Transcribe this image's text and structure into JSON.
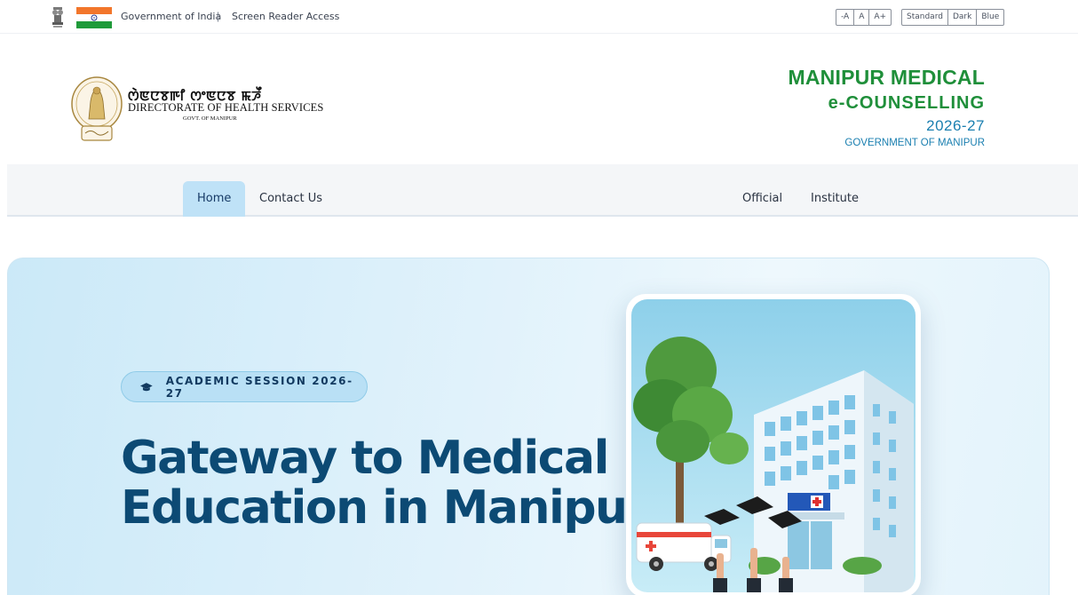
{
  "gov_strip": {
    "gov_label": "Government of India",
    "separator": "|",
    "screen_reader": "Screen Reader Access",
    "font_controls": [
      "-A",
      "A",
      "A+"
    ],
    "theme_controls": [
      "Standard",
      "Dark",
      "Blue"
    ]
  },
  "org": {
    "script_line": "ꯁꯥꯟꯅꯕꯒꯤ ꯁꯦꯟꯅꯕ ꯃꯍꯩ",
    "name": "DIRECTORATE OF HEALTH SERVICES",
    "sub": "GOVT. OF MANIPUR"
  },
  "brand": {
    "line1": "MANIPUR MEDICAL",
    "line2": "e-COUNSELLING",
    "line3": "2026-27",
    "line4": "GOVERNMENT OF MANIPUR"
  },
  "nav": {
    "left": [
      "Home",
      "Contact Us"
    ],
    "right": [
      "Official",
      "Institute"
    ],
    "active": "Home"
  },
  "hero": {
    "pill": "ACADEMIC SESSION 2026-27",
    "title_line1": "Gateway to Medical",
    "title_line2": "Education in Manipur"
  },
  "colors": {
    "brand_green": "#1f8f3a",
    "brand_blue": "#1a7fb0",
    "hero_title": "#0c4a74",
    "nav_active": "#bfe2f7"
  }
}
